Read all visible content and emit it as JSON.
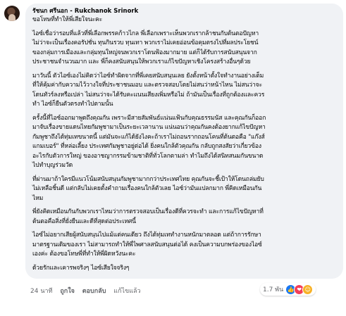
{
  "comment": {
    "author": "รัชนก ศรีนอก - Rukchanok Srinork",
    "paragraphs": [
      [
        "ขอโทษที่ทำให้พี่เสียใจนะคะ"
      ],
      [
        "ไอซ์เชื่อว่ารอบที่แล้วที่พี่เลือกพรรคก้าวไกล พี่เลือกเพราะเห็นพวกเรากล้าชนกับต้นตอปัญหา",
        "ไม่ว่าจะเป็นเรื่องคอรัปชั่น ทุนกินรวบ ทุนเทา พวกเราไม่เคยอ่อนข้อคุมตรงไปที่ผลประโยชน์",
        "ของกลุ่มการเมืองและกลุ่มทุนใหญ่จนพวกเราโดนฟ้องมากมาย แต่ก็ได้รับการสนับสนุนจาก",
        "ประชาชนจำนวนมาก และ พี่ก็คงสนับสนุนให้พวกเราแก้ไขปัญหาเชิงโครงสร้างอื่นๆด้วย"
      ],
      [
        "มาวันนี้ ตัวไอซ์เองไม่คิดว่าไอซ์ทำผิดจากที่พี่เคยสนับสนุนเลย ยังตั้งหน้าตั้งใจทำงานอย่างเต็ม",
        "ที่ให้คุ้มค่ากับความไว้วางใจที่ประชาชนมอบ และตรวจสอบโดยไม่สนว่าหน้าไหน ไม่สนว่าจะ",
        "โดนทัวร์ลงหรือเปล่า ไม่สนว่าจะได้รับคะแนนเสียงเพิ่มหรือไม่ ถ้ามันเป็นเรื่องที่ถูกต้องและควร",
        "ทำ ไอซ์ก็ยืนตัวตรงทำไปตามนั้น"
      ],
      [
        "ครั้งนี้ที่ไอซ์ออกมาพูดถึงคุณกัน เพราะมีสายสัมพันธ์แน่นแฟ้นกับคุณธรรมนัส และคุณกันก็ออก",
        "มาจับเรื่องขายแดนไทยกัมพูชามาเป็นระยะเวลานาน แน่นอนว่าคุณกันคงต้องยากแก้ไขปัญหา",
        "กัมพูชาถึงได้ทุ่มเทขนาดนี้ แต่มันจะแก้ได้ยังไงคะถ้าเราไม่ถอนรากถอนโคนที่ต้นตอคือ \"แก๊งส์",
        "แกมเบอร์\" ที่หล่อเลี้ยง ประเทศกัมพูชาอยู่ต่อได้ ยิ่งคนใกล้ตัวคุณกัน กลับถูกสงสัยว่าเกี่ยวข้อง",
        "อะไรกับตัวการใหญ่ ของอาชญากรรมข้ามชาติที่ทั่วโลกตามล่า ทำไมถึงได้สนิทสนมกันขนาด",
        "ไปทำบุญร่วมวัด"
      ],
      [
        "ที่ผ่านมาถ้าใครมีแนวโน้มสนับสนุนกัมพูชามากกว่าประเทศไทย คุณกันจะชี้เป้าให้โดนถล่มยับ",
        "ไม่เหลือชิ้นดี แต่กลับไม่เคยตั้งคำถามเรื่องคนใกล้ตัวเลย ไอซ์ว่ามันแปลกมาก พี่คิดเหมือนกัน",
        "ไหม"
      ],
      [
        "พี่ยังคิดเหมือนกันกับพวกเราไหมว่าการตรวจสอบเป็นเรื่องดีที่ควรจะทำ และการแก้ไขปัญหาที่",
        "ต้นตอคือสิ่งที่ยั่งยืนและดีที่สุดต่อประเทศนี้"
      ],
      [
        "ไอซ์ไม่อยากเสียผู้สนับสนุนไปแม้แต่คนเดียว ถึงได้ทุ่มเททำงานหนักมาตลอด แต่ถ้าการรักษา",
        "มาตรฐานเดิมของเรา ไม่สามารถทำให้พี่ไพศาลสนับสนุนต่อได้ คงเป็นความบกพร่องของไอซ์",
        "เองค่ะ ต้องขอโทษพี่ที่ทำให้พี่ผิดหวังนะคะ"
      ],
      [
        "ด้วยรักและเคารพจริงๆ ไอซ์เสียใจจริงๆ"
      ]
    ]
  },
  "actions": {
    "time": "24 นาที",
    "like": "ถูกใจ",
    "reply": "ตอบกลับ",
    "edited": "แก้ไขแล้ว"
  },
  "reactions": {
    "count": "1.7 พัน",
    "icons": [
      "like-icon",
      "love-icon",
      "care-icon"
    ]
  },
  "colors": {
    "bubble": "#f0f2f5",
    "meta_text": "#65676b",
    "like_blue": "#1877f2",
    "love_red": "#f33e58"
  }
}
